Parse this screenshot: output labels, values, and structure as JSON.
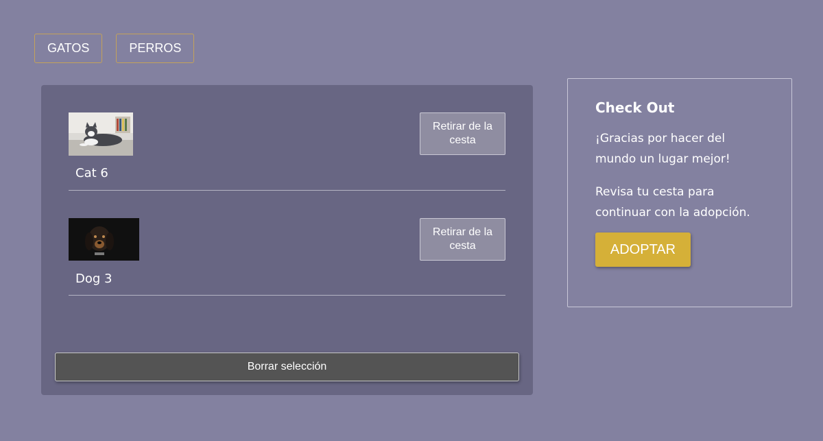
{
  "nav": {
    "cats_label": "GATOS",
    "dogs_label": "PERROS"
  },
  "cart": {
    "items": [
      {
        "name": "Cat 6",
        "remove_label": "Retirar de la cesta",
        "image": "cat-photo"
      },
      {
        "name": "Dog 3",
        "remove_label": "Retirar de la cesta",
        "image": "dog-photo"
      }
    ],
    "clear_label": "Borrar selección"
  },
  "checkout": {
    "title": "Check Out",
    "thanks_text": "¡Gracias por hacer del mundo un lugar mejor!",
    "review_text": "Revisa tu cesta para continuar con la adopción.",
    "adopt_label": "ADOPTAR"
  },
  "colors": {
    "page_background": "#8381a0",
    "panel_background": "#686683",
    "accent": "#d5b038",
    "nav_border": "#c4a25a",
    "clear_button": "#545454"
  }
}
